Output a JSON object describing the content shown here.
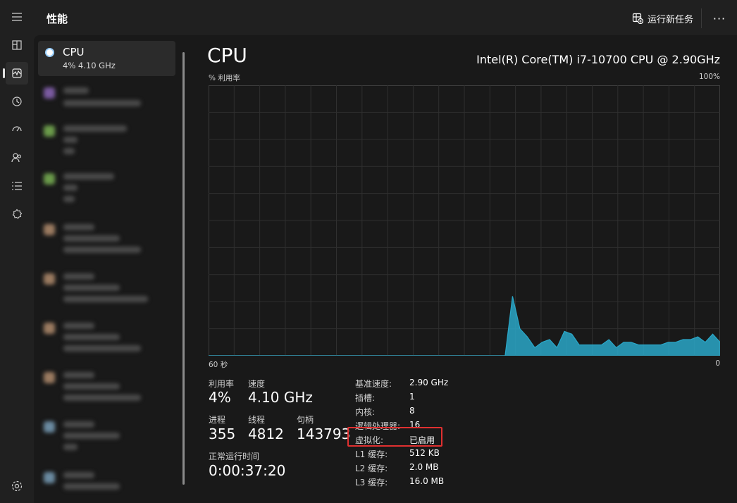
{
  "header": {
    "title": "性能",
    "run_task_label": "运行新任务",
    "more_label": "···"
  },
  "nav": {
    "items": [
      {
        "name": "hamburger-menu-icon"
      },
      {
        "name": "processes-icon"
      },
      {
        "name": "performance-icon"
      },
      {
        "name": "app-history-icon"
      },
      {
        "name": "startup-apps-icon"
      },
      {
        "name": "users-icon"
      },
      {
        "name": "details-icon"
      },
      {
        "name": "services-icon"
      },
      {
        "name": "settings-icon"
      }
    ]
  },
  "device_list": {
    "active": {
      "name": "CPU",
      "sub": "4%  4.10 GHz"
    }
  },
  "cpu": {
    "title": "CPU",
    "model": "Intel(R) Core(TM) i7-10700 CPU @ 2.90GHz",
    "y_label": "% 利用率",
    "y_max": "100%",
    "x_left": "60 秒",
    "x_right": "0"
  },
  "chart_data": {
    "type": "area",
    "xlabel": "",
    "ylabel": "% 利用率",
    "xlim": [
      60,
      0
    ],
    "ylim": [
      0,
      100
    ],
    "grid": true,
    "color": "#2aa7c8",
    "x": [
      60,
      59,
      58,
      57,
      56,
      55,
      54,
      53,
      52,
      51,
      50,
      49,
      48,
      47,
      46,
      45,
      44,
      43,
      42,
      41,
      40,
      39,
      38,
      37,
      36,
      35,
      34,
      33,
      32,
      31,
      30,
      29,
      28,
      27,
      26,
      25,
      24,
      23,
      22,
      21,
      20,
      19,
      18,
      17,
      17,
      16,
      15,
      14,
      13,
      12,
      11,
      10,
      9,
      8,
      7,
      6,
      5,
      4,
      3,
      2,
      1,
      0
    ],
    "values": [
      0,
      0,
      0,
      0,
      0,
      0,
      0,
      0,
      0,
      0,
      0,
      0,
      0,
      0,
      0,
      0,
      0,
      0,
      0,
      0,
      0,
      0,
      0,
      0,
      0,
      0,
      0,
      0,
      0,
      0,
      0,
      0,
      0,
      0,
      0,
      0,
      0,
      0,
      0,
      0,
      0,
      22,
      10,
      7,
      3,
      5,
      6,
      3,
      9,
      8,
      4,
      4,
      4,
      4,
      6,
      3,
      5,
      5,
      4,
      4,
      4,
      4,
      5,
      5,
      6,
      6,
      7,
      5,
      8,
      5
    ]
  },
  "stats": {
    "util_label": "利用率",
    "util_value": "4%",
    "speed_label": "速度",
    "speed_value": "4.10 GHz",
    "proc_label": "进程",
    "proc_value": "355",
    "thread_label": "线程",
    "thread_value": "4812",
    "handle_label": "句柄",
    "handle_value": "143793",
    "uptime_label": "正常运行时间",
    "uptime_value": "0:00:37:20"
  },
  "specs": [
    {
      "label": "基准速度:",
      "value": "2.90 GHz"
    },
    {
      "label": "插槽:",
      "value": "1"
    },
    {
      "label": "内核:",
      "value": "8"
    },
    {
      "label": "逻辑处理器:",
      "value": "16"
    },
    {
      "label": "虚拟化:",
      "value": "已启用"
    },
    {
      "label": "L1 缓存:",
      "value": "512 KB"
    },
    {
      "label": "L2 缓存:",
      "value": "2.0 MB"
    },
    {
      "label": "L3 缓存:",
      "value": "16.0 MB"
    }
  ]
}
